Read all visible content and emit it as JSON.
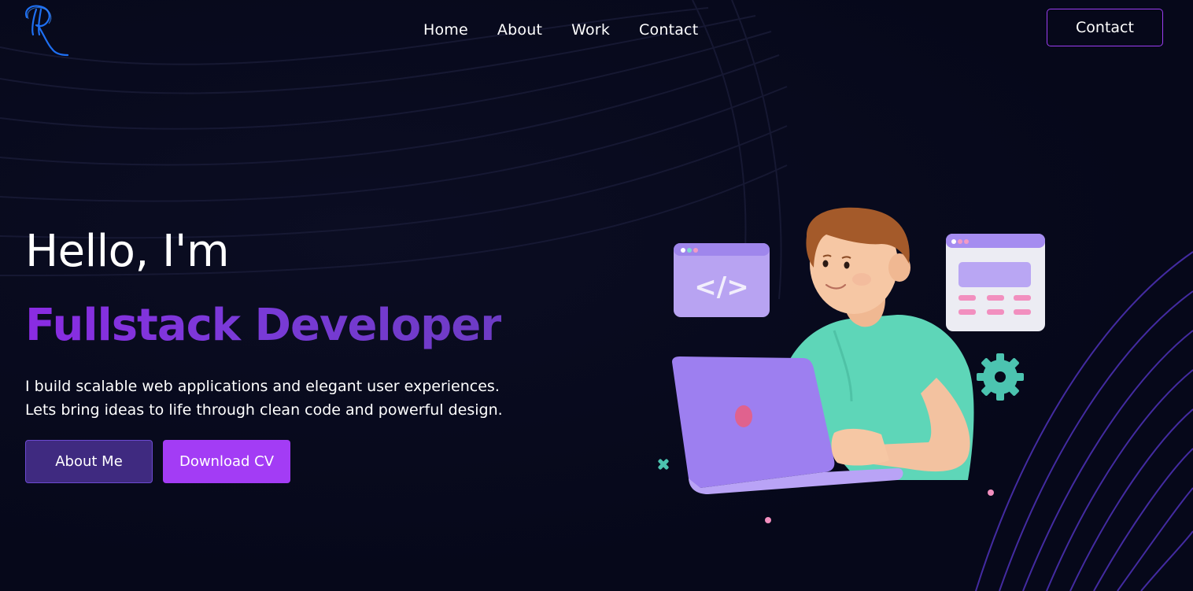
{
  "header": {
    "logo_letter": "R",
    "nav": [
      {
        "label": "Home"
      },
      {
        "label": "About"
      },
      {
        "label": "Work"
      },
      {
        "label": "Contact"
      }
    ],
    "contact_button": "Contact"
  },
  "hero": {
    "greeting": "Hello, I'm",
    "role": "Fullstack Developer",
    "description_line1": "I build scalable web applications and elegant user experiences.",
    "description_line2": "Lets bring ideas to life through clean code and powerful design.",
    "about_button": "About Me",
    "cv_button": "Download CV",
    "code_window_text": "</>"
  },
  "colors": {
    "background": "#06081a",
    "accent_purple": "#a33cf5",
    "about_button_bg": "#3f2a80",
    "role_gradient_start": "#8a2be2",
    "role_gradient_end": "#6d3bc4",
    "logo_blue": "#1e6ff2"
  }
}
